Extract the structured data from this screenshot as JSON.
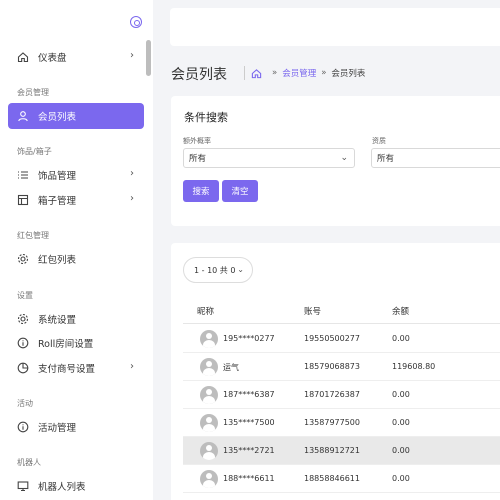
{
  "sidebar": {
    "dashboard": "仪表盘",
    "group_member": "会员管理",
    "member_list": "会员列表",
    "group_items": "饰品/箱子",
    "items_manage": "饰品管理",
    "box_manage": "箱子管理",
    "group_redpacket": "红包管理",
    "redpacket_list": "红包列表",
    "group_settings": "设置",
    "system_settings": "系统设置",
    "roll_settings": "Roll房间设置",
    "pay_settings": "支付商号设置",
    "group_activity": "活动",
    "activity_manage": "活动管理",
    "group_robot": "机器人",
    "robot_list": "机器人列表"
  },
  "header": {
    "title": "会员列表",
    "breadcrumb": [
      "会员管理",
      "会员列表"
    ]
  },
  "filter": {
    "title": "条件搜索",
    "field1_label": "额外概率",
    "field1_value": "所有",
    "field2_label": "资质",
    "field2_value": "所有",
    "search_label": "搜索",
    "clear_label": "清空"
  },
  "table": {
    "pager_text": "1 - 10 共 0",
    "headers": [
      "昵称",
      "账号",
      "余额"
    ],
    "rows": [
      {
        "nickname": "195****0277",
        "account": "19550500277",
        "balance": "0.00"
      },
      {
        "nickname": "运气",
        "account": "18579068873",
        "balance": "119608.80"
      },
      {
        "nickname": "187****6387",
        "account": "18701726387",
        "balance": "0.00"
      },
      {
        "nickname": "135****7500",
        "account": "13587977500",
        "balance": "0.00"
      },
      {
        "nickname": "135****2721",
        "account": "13588912721",
        "balance": "0.00"
      },
      {
        "nickname": "188****6611",
        "account": "18858846611",
        "balance": "0.00"
      }
    ]
  },
  "colors": {
    "accent": "#7b68ee"
  }
}
